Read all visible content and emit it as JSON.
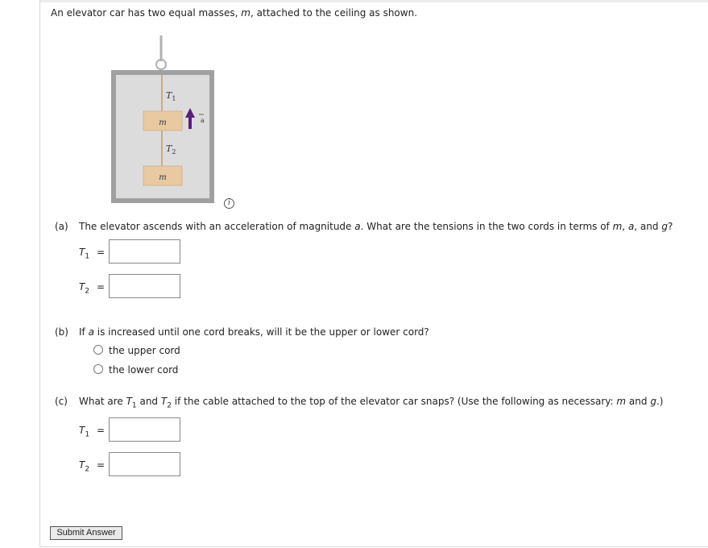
{
  "intro": {
    "prefix": "An elevator car has two equal masses, ",
    "m": "m",
    "suffix": ", attached to the ceiling as shown."
  },
  "figure": {
    "t1_var": "T",
    "t1_sub": "1",
    "t2_var": "T",
    "t2_sub": "2",
    "mass_label": "m",
    "accel_label": "a",
    "colors": {
      "frame": "#a0a0a0",
      "inner": "#dcdcdc",
      "mass": "#e8c9a2",
      "arrow": "#5a1e7a",
      "cord": "#caa680"
    }
  },
  "info_icon": "i",
  "part_a": {
    "label": "(a)",
    "q1": "The elevator ascends with an acceleration of magnitude ",
    "a": "a",
    "q2": ". What are the tensions in the two cords in terms of ",
    "m": "m",
    "sep1": ", ",
    "a2": "a",
    "sep2": ", and ",
    "g": "g",
    "q3": "?",
    "t1_var": "T",
    "t1_sub": "1",
    "t2_var": "T",
    "t2_sub": "2",
    "equals": "=",
    "t1_value": "",
    "t2_value": ""
  },
  "part_b": {
    "label": "(b)",
    "q1": "If ",
    "a": "a",
    "q2": " is increased until one cord breaks, will it be the upper or lower cord?",
    "options": [
      "the upper cord",
      "the lower cord"
    ]
  },
  "part_c": {
    "label": "(c)",
    "q1": "What are ",
    "t1_var": "T",
    "t1_sub": "1",
    "q2": " and ",
    "t2_var": "T",
    "t2_sub": "2",
    "q3": " if the cable attached to the top of the elevator car snaps? (Use the following as necessary: ",
    "m": "m",
    "q4": " and ",
    "g": "g",
    "q5": ".)",
    "equals": "=",
    "t1_value": "",
    "t2_value": ""
  },
  "submit_label": "Submit Answer"
}
